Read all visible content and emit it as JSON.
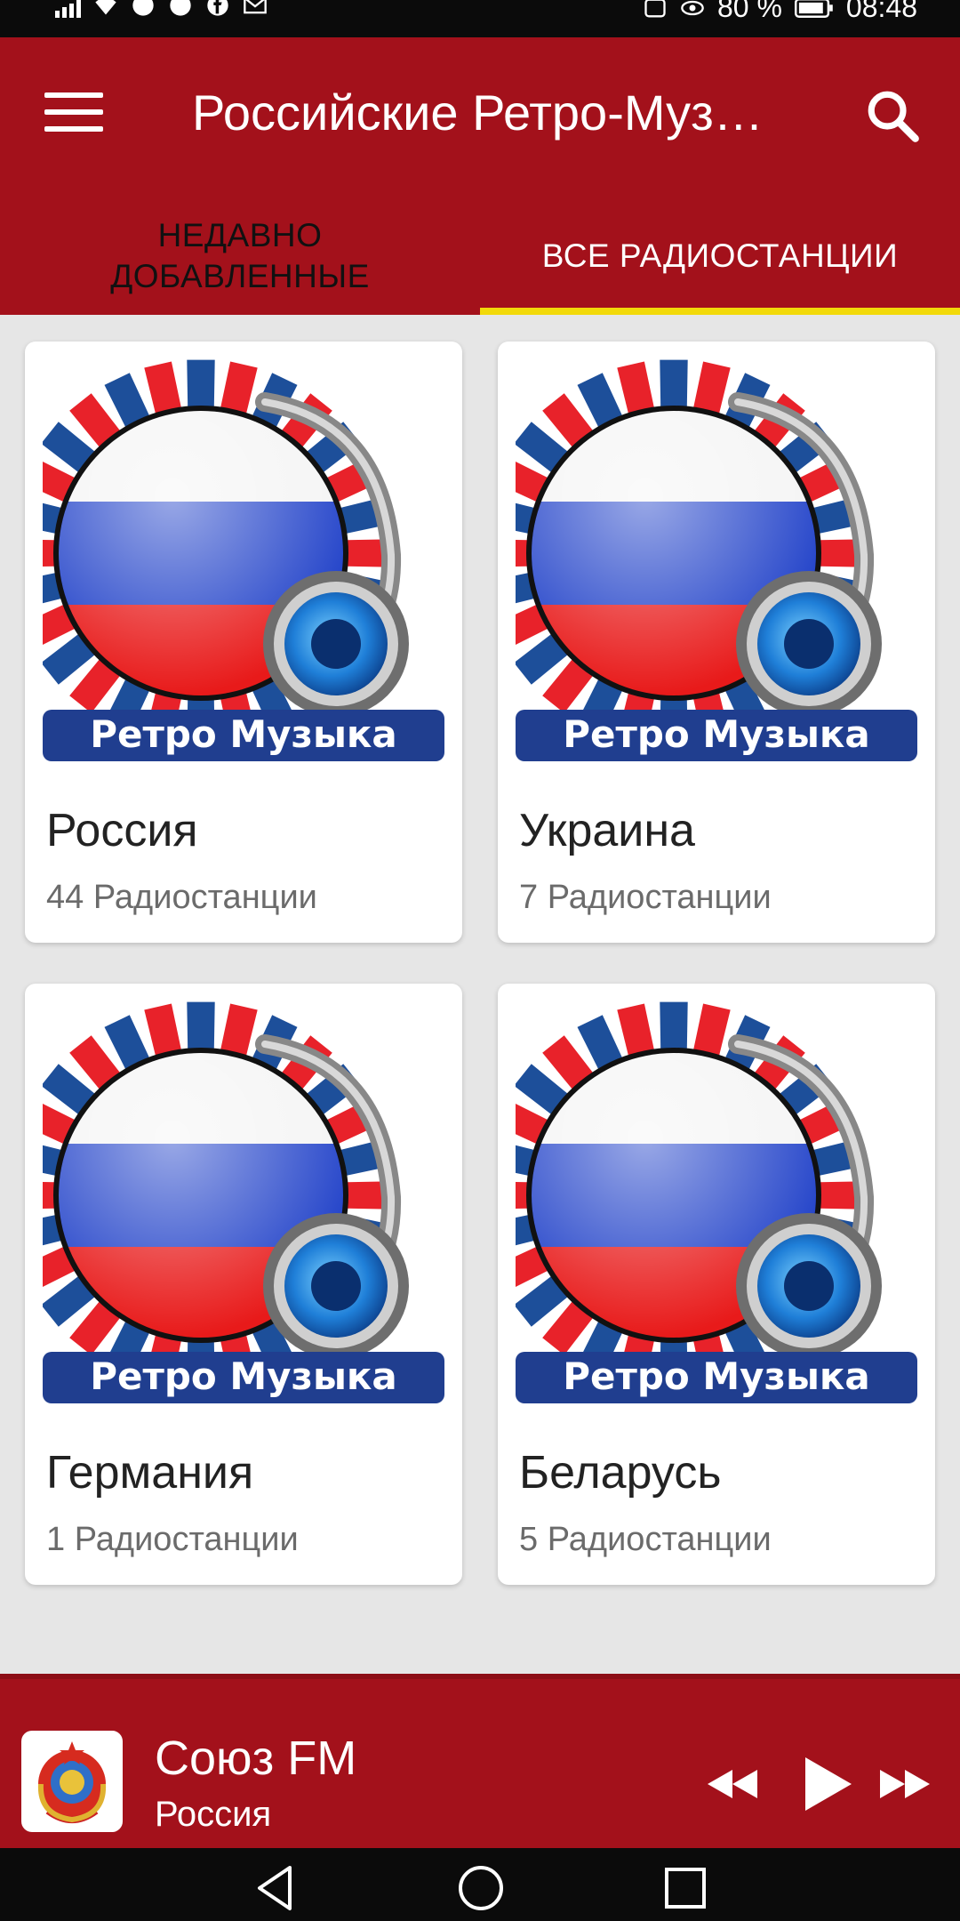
{
  "status_bar": {
    "battery": "80 %",
    "time": "08:48"
  },
  "app_bar": {
    "title": "Российские Ретро-Муз…"
  },
  "tabs": [
    {
      "label": "НЕДАВНО ДОБАВЛЕННЫЕ",
      "selected": false
    },
    {
      "label": "ВСЕ РАДИОСТАНЦИИ",
      "selected": true
    }
  ],
  "cards": [
    {
      "name": "Россия",
      "count": "44 Радиостанции",
      "logo_text": "Ретро Музыка"
    },
    {
      "name": "Украина",
      "count": "7 Радиостанции",
      "logo_text": "Ретро Музыка"
    },
    {
      "name": "Германия",
      "count": "1 Радиостанции",
      "logo_text": "Ретро Музыка"
    },
    {
      "name": "Беларусь",
      "count": "5 Радиостанции",
      "logo_text": "Ретро Музыка"
    }
  ],
  "player": {
    "title": "Союз FM",
    "subtitle": "Россия"
  },
  "colors": {
    "primary": "#a3111b",
    "tab_indicator": "#f2d90a",
    "background": "#e6e6e6"
  },
  "icons": [
    "menu-icon",
    "search-icon",
    "rewind-icon",
    "play-icon",
    "fast-forward-icon",
    "back-icon",
    "home-icon",
    "recents-icon"
  ]
}
